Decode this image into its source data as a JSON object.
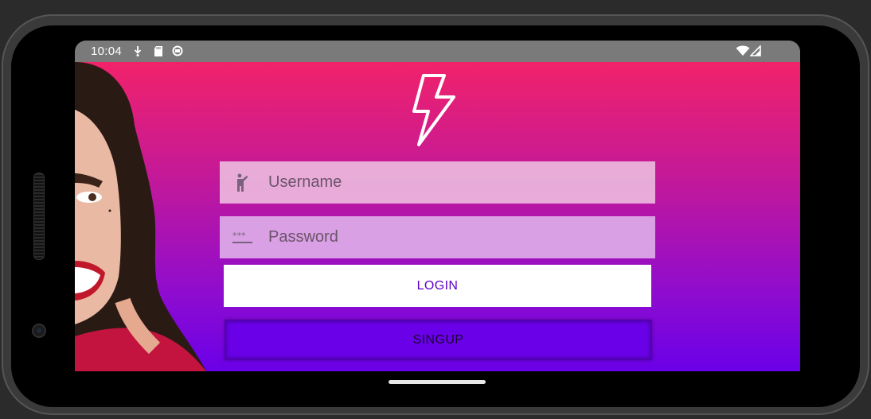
{
  "status_bar": {
    "time": "10:04",
    "left_icons": [
      "download-icon",
      "sd-card-icon",
      "sync-icon"
    ],
    "right_icons": [
      "wifi-icon",
      "signal-icon"
    ]
  },
  "app": {
    "logo_icon": "lightning-bolt-icon",
    "username": {
      "placeholder": "Username",
      "icon": "person-icon"
    },
    "password": {
      "placeholder": "Password",
      "icon": "password-dots-icon"
    },
    "login_label": "LOGIN",
    "signup_label": "SINGUP"
  },
  "colors": {
    "gradient_top": "#f1226a",
    "gradient_bottom": "#6a00e8",
    "login_text": "#5a00c8",
    "status_bar": "#7a7a7a"
  }
}
